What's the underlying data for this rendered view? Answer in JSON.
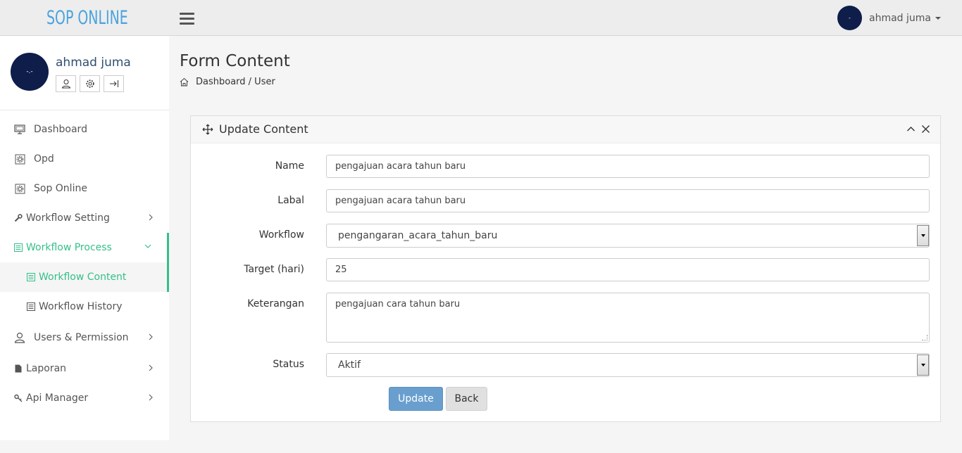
{
  "brand": "SOP ONLINE",
  "topbar": {
    "user_name": "ahmad juma",
    "avatar_text": "-"
  },
  "sidebar": {
    "profile": {
      "name": "ahmad juma",
      "avatar_text": "-.-"
    },
    "items": [
      {
        "label": "Dashboard",
        "icon": "monitor-icon"
      },
      {
        "label": "Opd",
        "icon": "gear-box-icon"
      },
      {
        "label": "Sop Online",
        "icon": "gear-box-icon"
      },
      {
        "label": "Workflow Setting",
        "icon": "wrench-icon",
        "expandable": true
      },
      {
        "label": "Workflow Process",
        "icon": "list-icon",
        "expandable": true,
        "expanded": true,
        "active": true,
        "children": [
          {
            "label": "Workflow Content",
            "icon": "list-icon",
            "active": true
          },
          {
            "label": "Workflow History",
            "icon": "list-icon"
          }
        ]
      },
      {
        "label": "Users & Permission",
        "icon": "user-icon",
        "expandable": true
      },
      {
        "label": "Laporan",
        "icon": "file-icon",
        "expandable": true
      },
      {
        "label": "Api Manager",
        "icon": "key-icon",
        "expandable": true
      }
    ]
  },
  "page": {
    "title": "Form Content",
    "breadcrumb": "Dashboard / User"
  },
  "panel": {
    "title": "Update Content",
    "form": {
      "name_label": "Name",
      "name_value": "pengajuan acara tahun baru",
      "labal_label": "Labal",
      "labal_value": "pengajuan acara tahun baru",
      "workflow_label": "Workflow",
      "workflow_value": "pengangaran_acara_tahun_baru",
      "target_label": "Target (hari)",
      "target_value": "25",
      "keterangan_label": "Keterangan",
      "keterangan_value": "pengajuan cara tahun baru",
      "status_label": "Status",
      "status_value": "Aktif"
    },
    "buttons": {
      "update": "Update",
      "back": "Back"
    }
  },
  "colors": {
    "accent": "#34c08a",
    "brand": "#4aa3df",
    "primary_button": "#699fce",
    "avatar": "#0e1d4a"
  }
}
